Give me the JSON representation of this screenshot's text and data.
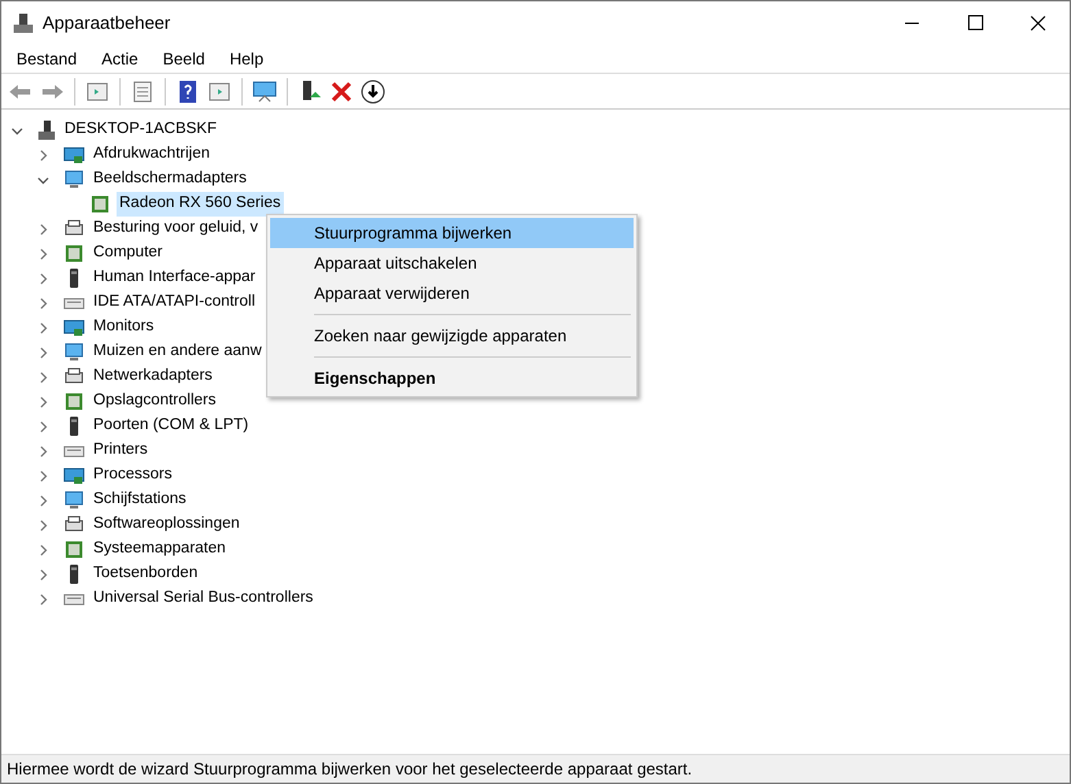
{
  "window": {
    "title": "Apparaatbeheer"
  },
  "menu_bar": [
    "Bestand",
    "Actie",
    "Beeld",
    "Help"
  ],
  "tree": {
    "label": "DESKTOP-1ACBSKF",
    "expanded": true,
    "selected": false,
    "children": [
      {
        "label": "Afdrukwachtrijen",
        "expanded": false,
        "selected": false
      },
      {
        "label": "Beeldschermadapters",
        "expanded": true,
        "selected": false,
        "children": [
          {
            "label": "Radeon RX 560 Series",
            "selected": true
          }
        ]
      },
      {
        "label": "Besturing voor geluid, v",
        "expanded": false,
        "selected": false
      },
      {
        "label": "Computer",
        "expanded": false,
        "selected": false
      },
      {
        "label": "Human Interface-appar",
        "expanded": false,
        "selected": false
      },
      {
        "label": "IDE ATA/ATAPI-controll",
        "expanded": false,
        "selected": false
      },
      {
        "label": "Monitors",
        "expanded": false,
        "selected": false
      },
      {
        "label": "Muizen en andere aanw",
        "expanded": false,
        "selected": false
      },
      {
        "label": "Netwerkadapters",
        "expanded": false,
        "selected": false
      },
      {
        "label": "Opslagcontrollers",
        "expanded": false,
        "selected": false
      },
      {
        "label": "Poorten (COM & LPT)",
        "expanded": false,
        "selected": false
      },
      {
        "label": "Printers",
        "expanded": false,
        "selected": false
      },
      {
        "label": "Processors",
        "expanded": false,
        "selected": false
      },
      {
        "label": "Schijfstations",
        "expanded": false,
        "selected": false
      },
      {
        "label": "Softwareoplossingen",
        "expanded": false,
        "selected": false
      },
      {
        "label": "Systeemapparaten",
        "expanded": false,
        "selected": false
      },
      {
        "label": "Toetsenborden",
        "expanded": false,
        "selected": false
      },
      {
        "label": "Universal Serial Bus-controllers",
        "expanded": false,
        "selected": false
      }
    ]
  },
  "context_menu": [
    {
      "kind": "item",
      "label": "Stuurprogramma bijwerken",
      "selected": true,
      "default": false
    },
    {
      "kind": "item",
      "label": "Apparaat uitschakelen",
      "selected": false,
      "default": false
    },
    {
      "kind": "item",
      "label": "Apparaat verwijderen",
      "selected": false,
      "default": false
    },
    {
      "kind": "separator"
    },
    {
      "kind": "item",
      "label": "Zoeken naar gewijzigde apparaten",
      "selected": false,
      "default": false
    },
    {
      "kind": "separator"
    },
    {
      "kind": "item",
      "label": "Eigenschappen",
      "selected": false,
      "default": true
    }
  ],
  "status_bar": "Hiermee wordt de wizard Stuurprogramma bijwerken voor het geselecteerde apparaat gestart."
}
